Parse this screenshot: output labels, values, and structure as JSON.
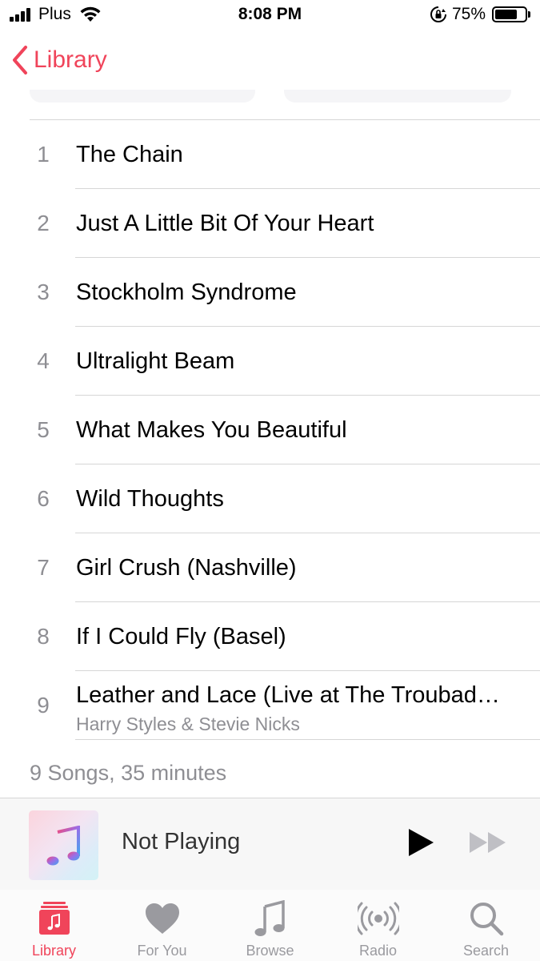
{
  "status_bar": {
    "carrier": "Plus",
    "time": "8:08 PM",
    "battery_pct": "75%",
    "battery_level": 0.75
  },
  "nav": {
    "back_label": "Library"
  },
  "tracks": [
    {
      "num": "1",
      "title": "The Chain"
    },
    {
      "num": "2",
      "title": "Just A Little Bit Of Your Heart"
    },
    {
      "num": "3",
      "title": "Stockholm Syndrome"
    },
    {
      "num": "4",
      "title": "Ultralight Beam"
    },
    {
      "num": "5",
      "title": "What Makes You Beautiful"
    },
    {
      "num": "6",
      "title": "Wild Thoughts"
    },
    {
      "num": "7",
      "title": "Girl Crush (Nashville)"
    },
    {
      "num": "8",
      "title": "If I Could Fly (Basel)"
    },
    {
      "num": "9",
      "title": "Leather and Lace (Live at The Troubad…",
      "artist": "Harry Styles & Stevie Nicks"
    }
  ],
  "summary": "9 Songs, 35 minutes",
  "mini_player": {
    "status": "Not Playing",
    "artwork_icon": "music-note-icon"
  },
  "tabs": [
    {
      "label": "Library",
      "icon": "library-icon",
      "active": true
    },
    {
      "label": "For You",
      "icon": "heart-icon",
      "active": false
    },
    {
      "label": "Browse",
      "icon": "music-note-icon",
      "active": false
    },
    {
      "label": "Radio",
      "icon": "radio-icon",
      "active": false
    },
    {
      "label": "Search",
      "icon": "search-icon",
      "active": false
    }
  ],
  "colors": {
    "accent": "#f0445a",
    "secondary_text": "#8e8e93",
    "inactive_tab": "#9a9a9f"
  }
}
